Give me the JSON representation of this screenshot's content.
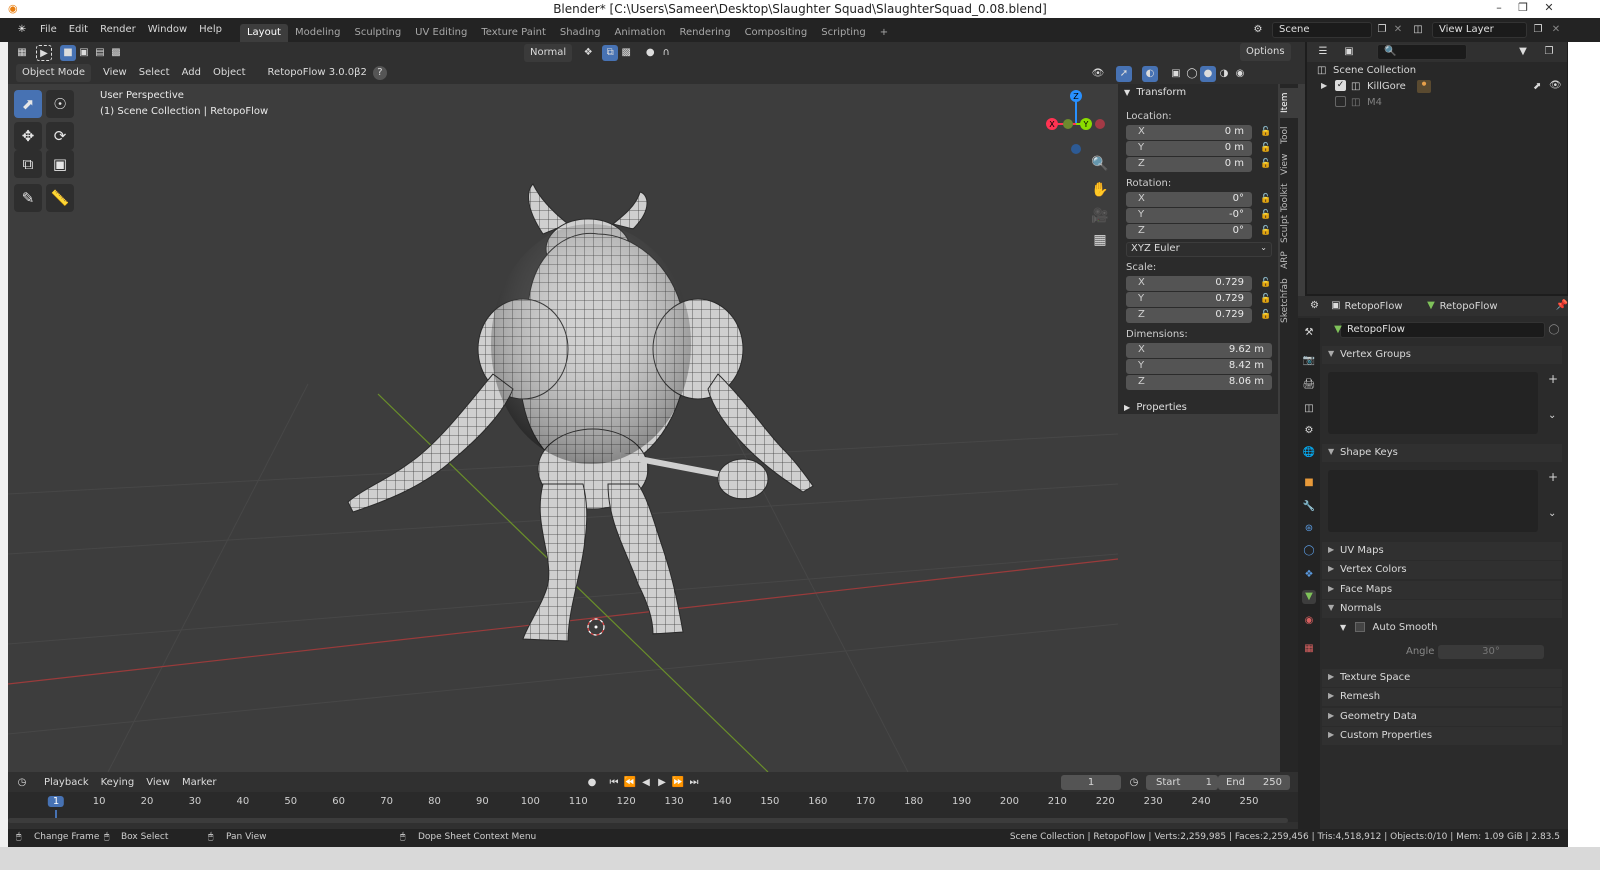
{
  "window": {
    "title": "Blender* [C:\\Users\\Sameer\\Desktop\\Slaughter Squad\\SlaughterSquad_0.08.blend]",
    "controls": [
      "–",
      "❐",
      "✕"
    ]
  },
  "menus": [
    "File",
    "Edit",
    "Render",
    "Window",
    "Help"
  ],
  "workspaces": [
    "Layout",
    "Modeling",
    "Sculpting",
    "UV Editing",
    "Texture Paint",
    "Shading",
    "Animation",
    "Rendering",
    "Compositing",
    "Scripting"
  ],
  "active_workspace": "Layout",
  "add_workspace": "+",
  "scene": {
    "label": "Scene",
    "view_layer": "View Layer"
  },
  "viewport_header": {
    "orientation": "Normal",
    "options": "Options",
    "mode": "Object Mode",
    "menus": [
      "View",
      "Select",
      "Add",
      "Object"
    ],
    "addon": "RetopoFlow 3.0.0β2",
    "help": "?"
  },
  "overlay": {
    "perspective": "User Perspective",
    "collection": "(1) Scene Collection | RetopoFlow"
  },
  "gizmo": {
    "x": "X",
    "y": "Y",
    "z": "Z"
  },
  "transform": {
    "title": "Transform",
    "location_label": "Location:",
    "location": [
      {
        "axis": "X",
        "value": "0 m"
      },
      {
        "axis": "Y",
        "value": "0 m"
      },
      {
        "axis": "Z",
        "value": "0 m"
      }
    ],
    "rotation_label": "Rotation:",
    "rotation": [
      {
        "axis": "X",
        "value": "0°"
      },
      {
        "axis": "Y",
        "value": "-0°"
      },
      {
        "axis": "Z",
        "value": "0°"
      }
    ],
    "rotation_mode": "XYZ Euler",
    "scale_label": "Scale:",
    "scale": [
      {
        "axis": "X",
        "value": "0.729"
      },
      {
        "axis": "Y",
        "value": "0.729"
      },
      {
        "axis": "Z",
        "value": "0.729"
      }
    ],
    "dimensions_label": "Dimensions:",
    "dimensions": [
      {
        "axis": "X",
        "value": "9.62 m"
      },
      {
        "axis": "Y",
        "value": "8.42 m"
      },
      {
        "axis": "Z",
        "value": "8.06 m"
      }
    ],
    "properties": "Properties"
  },
  "side_tabs": [
    "Item",
    "Tool",
    "View",
    "Sculpt Toolkit",
    "ARP",
    "Sketchfab"
  ],
  "outliner": {
    "root": "Scene Collection",
    "items": [
      "KillGore",
      "M4"
    ]
  },
  "properties_panel": {
    "object_name": "RetopoFlow",
    "mesh_name": "RetopoFlow",
    "data_name": "RetopoFlow",
    "sections": [
      "Vertex Groups",
      "Shape Keys",
      "UV Maps",
      "Vertex Colors",
      "Face Maps",
      "Normals"
    ],
    "auto_smooth": "Auto Smooth",
    "angle_label": "Angle",
    "angle_value": "30°",
    "more_sections": [
      "Texture Space",
      "Remesh",
      "Geometry Data",
      "Custom Properties"
    ]
  },
  "timeline": {
    "menus": [
      "Playback",
      "Keying",
      "View",
      "Marker"
    ],
    "current_frame": "1",
    "start_label": "Start",
    "start": "1",
    "end_label": "End",
    "end": "250",
    "ticks": [
      "1",
      "10",
      "20",
      "30",
      "40",
      "50",
      "60",
      "70",
      "80",
      "90",
      "100",
      "110",
      "120",
      "130",
      "140",
      "150",
      "160",
      "170",
      "180",
      "190",
      "200",
      "210",
      "220",
      "230",
      "240",
      "250"
    ]
  },
  "statusbar": {
    "hints": [
      "Change Frame",
      "Box Select",
      "Pan View",
      "Dope Sheet Context Menu"
    ],
    "stats": "Scene Collection | RetopoFlow | Verts:2,259,985 | Faces:2,259,456 | Tris:4,518,912 | Objects:0/10 | Mem: 1.09 GiB | 2.83.5"
  },
  "colors": {
    "accent": "#4772b3",
    "x_axis": "#ff3352",
    "y_axis": "#8bdc00",
    "z_axis": "#2890ff",
    "mesh": "#c9c9c9"
  }
}
